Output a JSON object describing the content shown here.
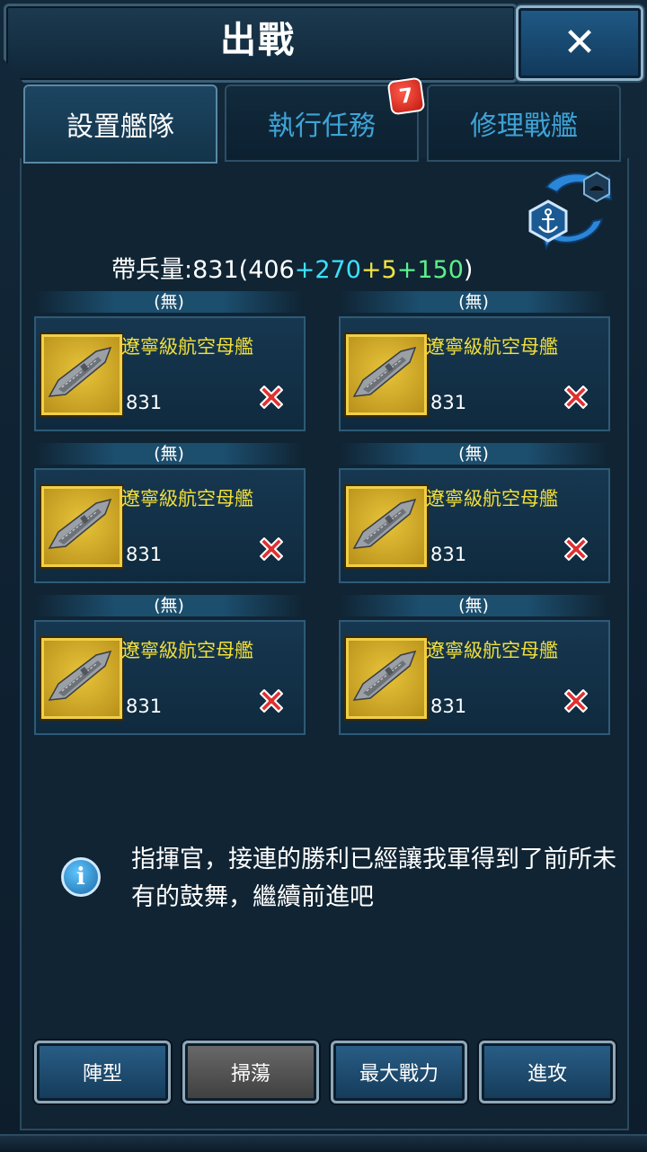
{
  "header": {
    "title": "出戰",
    "close_label": "✕"
  },
  "tabs": [
    {
      "label": "設置艦隊",
      "active": true
    },
    {
      "label": "執行任務",
      "active": false,
      "badge": "7"
    },
    {
      "label": "修理戰艦",
      "active": false
    }
  ],
  "troops": {
    "label": "帶兵量:",
    "total": "831",
    "open": "(",
    "base": "406",
    "plus1": "+270",
    "plus2": "+5",
    "plus3": "+150",
    "close": ")"
  },
  "slots": [
    {
      "label": "(無)",
      "name": "遼寧級航空母艦",
      "power": "831"
    },
    {
      "label": "(無)",
      "name": "遼寧級航空母艦",
      "power": "831"
    },
    {
      "label": "(無)",
      "name": "遼寧級航空母艦",
      "power": "831"
    },
    {
      "label": "(無)",
      "name": "遼寧級航空母艦",
      "power": "831"
    },
    {
      "label": "(無)",
      "name": "遼寧級航空母艦",
      "power": "831"
    },
    {
      "label": "(無)",
      "name": "遼寧級航空母艦",
      "power": "831"
    }
  ],
  "info": {
    "icon": "i",
    "text": "指揮官，接連的勝利已經讓我軍得到了前所未有的鼓舞，繼續前進吧"
  },
  "buttons": {
    "formation": "陣型",
    "sweep": "掃蕩",
    "max_power": "最大戰力",
    "attack": "進攻"
  },
  "colors": {
    "accent": "#3fa3d6",
    "gold": "#f2df3a",
    "remove": "#e03030"
  }
}
